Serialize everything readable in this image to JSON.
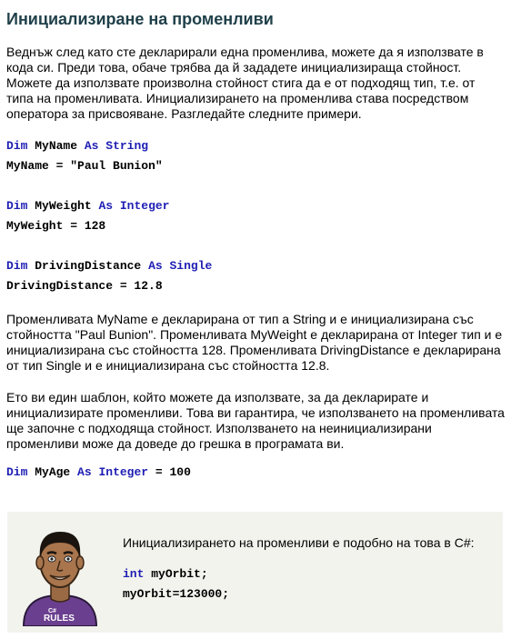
{
  "title": "Инициализиране на променливи",
  "intro": "Веднъж след като сте декларирали една променлива, можете да я използвате в кода си. Преди това, обаче трябва да й зададете инициализираща стойност. Можете да използвате произволна стойност стига да е от подходящ тип, т.е. от типа на променливата. Инициализирането на променлива става посредством оператора за присвояване. Разгледайте следните примери.",
  "examples": [
    {
      "dim": "Dim",
      "name": "MyName",
      "as": "As",
      "type": "String",
      "assign": "MyName = \"Paul Bunion\""
    },
    {
      "dim": "Dim",
      "name": "MyWeight",
      "as": "As",
      "type": "Integer",
      "assign": "MyWeight = 128"
    },
    {
      "dim": "Dim",
      "name": "DrivingDistance",
      "as": "As",
      "type": "Single",
      "assign": "DrivingDistance = 12.8"
    }
  ],
  "explanation": "Променливата MyName е декларирана от тип a String и е инициализирана със стойността \"Paul Bunion\". Променливата MyWeight е декларирана от Integer тип и е инициализирана със стойността 128. Променливата DrivingDistance е декларирана от тип Single и е инициализирана със стойността 12.8.",
  "template_text": "Ето ви един шаблон, който можете да използвате, за да декларирате и инициализирате променливи. Това ви гарантира, че използването на променливата ще започне с подходяща стойност. Използването на неинициализирани променливи може да доведе до грешка в програмата ви.",
  "template_code": {
    "dim": "Dim",
    "name": "MyAge",
    "as": "As",
    "type": "Integer",
    "rest": "= 100"
  },
  "callout": {
    "text": "Инициализирането на променливи е подобно на това в C#:",
    "kw": "int",
    "line1": "myOrbit;",
    "line2": "myOrbit=123000;",
    "shirt_text": "RULES",
    "badge": "C#"
  },
  "colors": {
    "heading": "#20404a",
    "keyword": "#1e1eb4",
    "callout_bg": "#f3f3ee",
    "shirt": "#6b3f8f"
  }
}
